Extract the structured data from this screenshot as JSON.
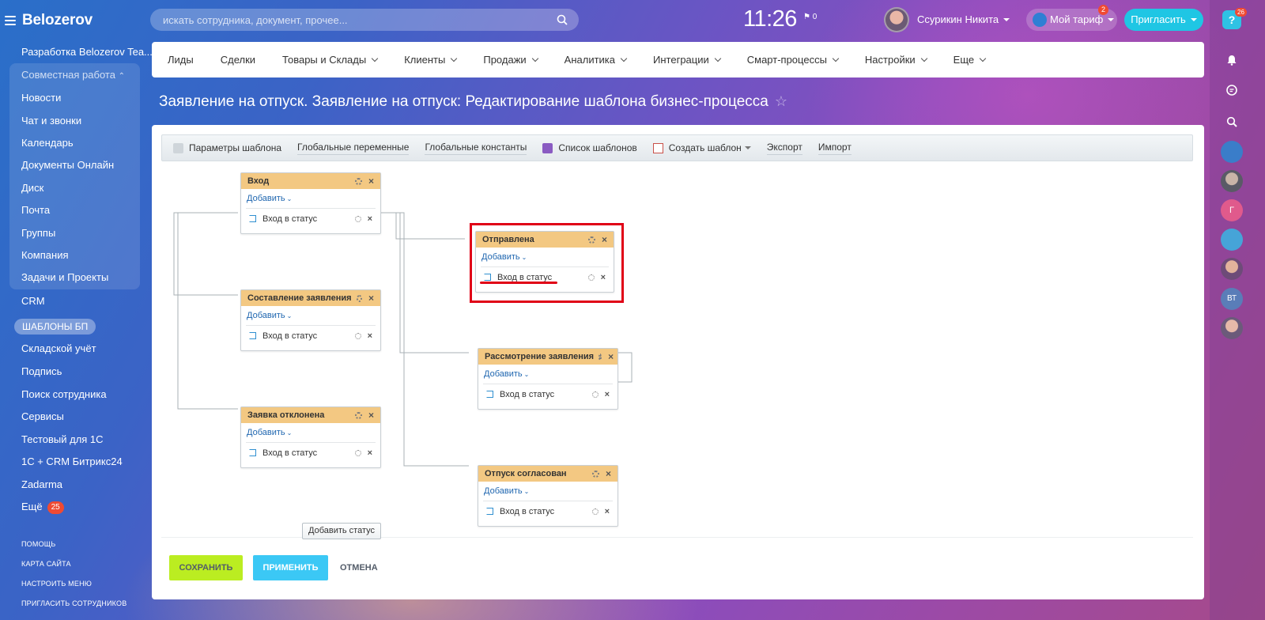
{
  "app": {
    "logo": "Belozerov"
  },
  "sidebar": {
    "items": [
      {
        "label": "Разработка Belozerov Tea..."
      },
      {
        "label": "Совместная работа"
      },
      {
        "label": "Новости"
      },
      {
        "label": "Чат и звонки"
      },
      {
        "label": "Календарь"
      },
      {
        "label": "Документы Онлайн"
      },
      {
        "label": "Диск"
      },
      {
        "label": "Почта"
      },
      {
        "label": "Группы"
      },
      {
        "label": "Компания"
      },
      {
        "label": "Задачи и Проекты"
      },
      {
        "label": "CRM"
      },
      {
        "label": "ШАБЛОНЫ БП"
      },
      {
        "label": "Складской учёт"
      },
      {
        "label": "Подпись"
      },
      {
        "label": "Поиск сотрудника"
      },
      {
        "label": "Сервисы"
      },
      {
        "label": "Тестовый для 1С"
      },
      {
        "label": "1С + CRM Битрикс24"
      },
      {
        "label": "Zadarma"
      },
      {
        "label": "Ещё",
        "badge": "25"
      }
    ],
    "links": [
      "помощь",
      "карта сайта",
      "настроить меню",
      "пригласить сотрудников"
    ]
  },
  "header": {
    "search_placeholder": "искать сотрудника, документ, прочее...",
    "clock": "11:26",
    "flag_count": "0",
    "user_name": "Ссурикин Никита",
    "tariff_label": "Мой тариф",
    "tariff_badge": "2",
    "invite_label": "Пригласить",
    "help_badge": "26"
  },
  "rightbar": {
    "avatars": [
      "Г",
      "ВТ"
    ]
  },
  "nav": [
    {
      "label": "Лиды",
      "dropdown": false
    },
    {
      "label": "Сделки",
      "dropdown": false
    },
    {
      "label": "Товары и Склады",
      "dropdown": true
    },
    {
      "label": "Клиенты",
      "dropdown": true
    },
    {
      "label": "Продажи",
      "dropdown": true
    },
    {
      "label": "Аналитика",
      "dropdown": true
    },
    {
      "label": "Интеграции",
      "dropdown": true
    },
    {
      "label": "Смарт-процессы",
      "dropdown": true
    },
    {
      "label": "Настройки",
      "dropdown": true
    },
    {
      "label": "Еще",
      "dropdown": true
    }
  ],
  "page_title": "Заявление на отпуск. Заявление на отпуск: Редактирование шаблона бизнес-процесса",
  "toolbar": {
    "params": "Параметры шаблона",
    "globals": "Глобальные переменные",
    "constants": "Глобальные константы",
    "list": "Список шаблонов",
    "create": "Создать шаблон",
    "export": "Экспорт",
    "import": "Импорт"
  },
  "states": [
    {
      "title": "Вход",
      "add": "Добавить",
      "sub": "Вход в статус"
    },
    {
      "title": "Отправлена",
      "add": "Добавить",
      "sub": "Вход в статус"
    },
    {
      "title": "Составление заявления",
      "add": "Добавить",
      "sub": "Вход в статус"
    },
    {
      "title": "Рассмотрение заявления",
      "add": "Добавить",
      "sub": "Вход в статус"
    },
    {
      "title": "Заявка отклонена",
      "add": "Добавить",
      "sub": "Вход в статус"
    },
    {
      "title": "Отпуск согласован",
      "add": "Добавить",
      "sub": "Вход в статус"
    }
  ],
  "add_status": "Добавить статус",
  "buttons": {
    "save": "СОХРАНИТЬ",
    "apply": "ПРИМЕНИТЬ",
    "cancel": "ОТМЕНА"
  },
  "colors": {
    "accent_green": "#bbed21",
    "accent_blue": "#3bc8f5",
    "state_header": "#f3c882",
    "highlight": "#e00016"
  }
}
